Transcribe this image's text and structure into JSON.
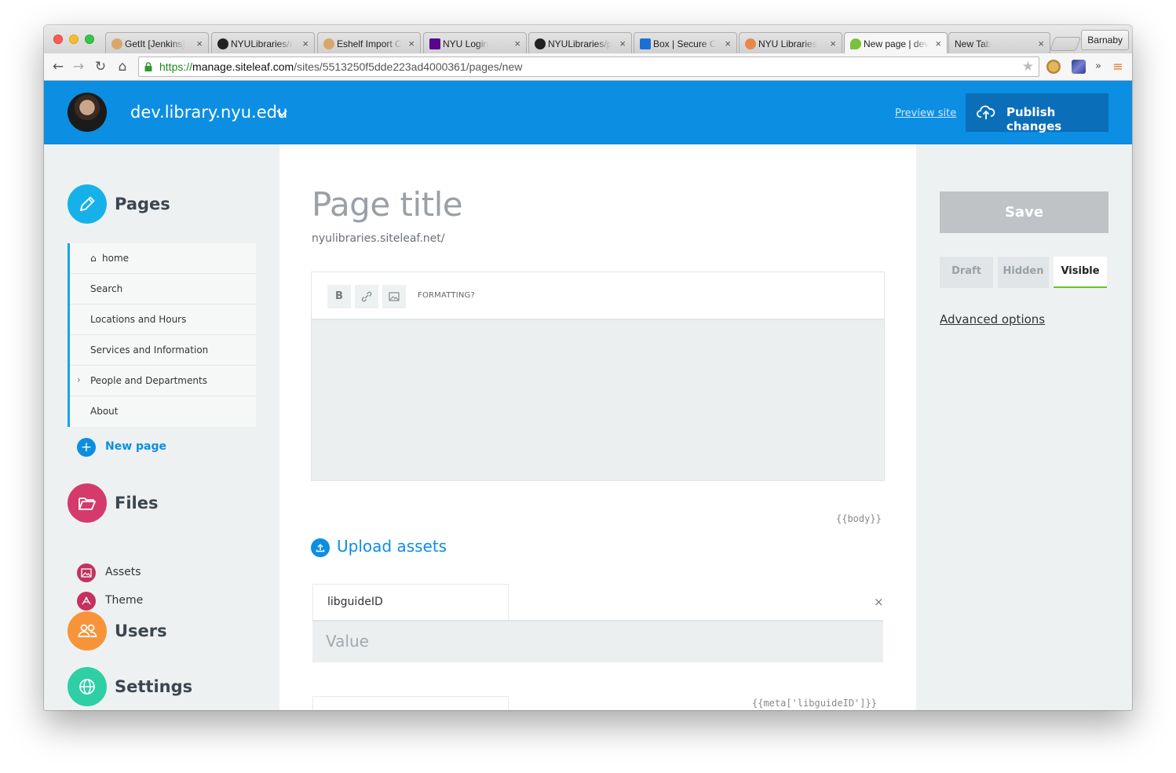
{
  "browser": {
    "tabs": [
      {
        "title": "GetIt [Jenkins]",
        "favicon": "butler-icon"
      },
      {
        "title": "NYULibraries/r",
        "favicon": "github-icon"
      },
      {
        "title": "Eshelf Import C",
        "favicon": "butler-icon"
      },
      {
        "title": "NYU Login",
        "favicon": "nyu-torch-icon"
      },
      {
        "title": "NYULibraries/p",
        "favicon": "github-icon"
      },
      {
        "title": "Box | Secure C",
        "favicon": "box-icon"
      },
      {
        "title": "NYU Libraries",
        "favicon": "nyu-libraries-icon"
      },
      {
        "title": "New page | dev",
        "favicon": "siteleaf-leaf-icon",
        "active": true
      },
      {
        "title": "New Tab",
        "favicon": ""
      }
    ],
    "profile_name": "Barnaby",
    "url": {
      "scheme": "https://",
      "host": "manage.siteleaf.com",
      "path": "/sites/5513250f5dde223ad4000361/pages/new"
    }
  },
  "header": {
    "site_name": "dev.library.nyu.edu",
    "preview_label": "Preview site",
    "publish_label": "Publish changes",
    "brand_color": "#0c8ee2"
  },
  "sidebar": {
    "pages_title": "Pages",
    "pages": [
      {
        "label": "home",
        "icon": "home-icon"
      },
      {
        "label": "Search"
      },
      {
        "label": "Locations and Hours"
      },
      {
        "label": "Services and Information"
      },
      {
        "label": "People and Departments",
        "has_children": true
      },
      {
        "label": "About"
      }
    ],
    "new_page_label": "New page",
    "files_title": "Files",
    "files": [
      {
        "label": "Assets",
        "icon": "image-icon"
      },
      {
        "label": "Theme",
        "icon": "theme-icon"
      }
    ],
    "users_title": "Users",
    "settings_title": "Settings",
    "section_colors": {
      "pages": "#17b1ea",
      "files": "#d43a6c",
      "users": "#f7943a",
      "settings": "#2ecfa5"
    }
  },
  "editor": {
    "title_placeholder": "Page title",
    "url_prefix": "nyulibraries.siteleaf.net/",
    "bold_label": "B",
    "formatting_label": "FORMATTING?",
    "body_tag": "{{body}}",
    "upload_label": "Upload assets",
    "meta": {
      "key": "libguideID",
      "value_placeholder": "Value",
      "tag": "{{meta['libguideID']}}"
    }
  },
  "right_panel": {
    "save_label": "Save",
    "states": [
      "Draft",
      "Hidden",
      "Visible"
    ],
    "active_state": "Visible",
    "advanced_label": "Advanced options"
  }
}
